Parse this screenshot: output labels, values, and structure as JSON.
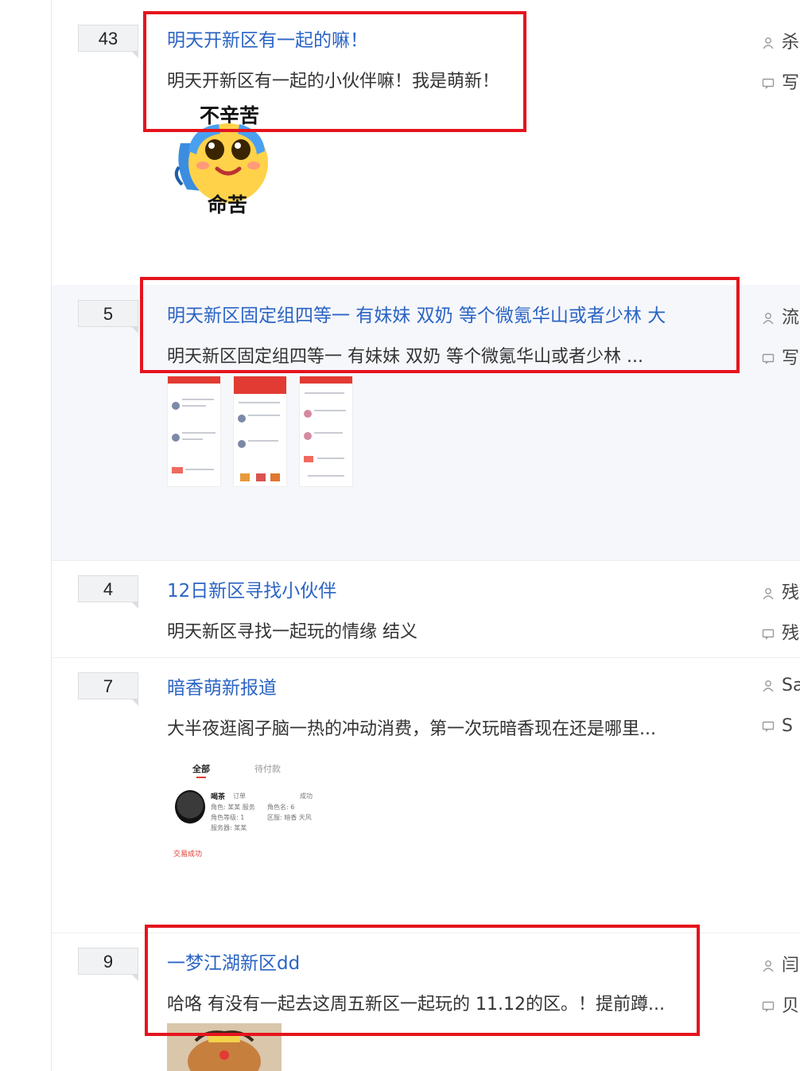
{
  "colors": {
    "title_link": "#2b64c4",
    "highlight_box": "#e5141d",
    "badge_bg": "#f1f2f4",
    "alt_row_bg": "#f6f7fb"
  },
  "icons": {
    "author": "person-icon",
    "reply": "comment-icon"
  },
  "rows": [
    {
      "count": "43",
      "title": "明天开新区有一起的嘛！",
      "snippet": "明天开新区有一起的小伙伴嘛！我是萌新！",
      "author": "杀",
      "last": "写",
      "emoji_top": "不辛苦",
      "emoji_bottom": "命苦"
    },
    {
      "count": "5",
      "title": "明天新区固定组四等一 有妹妹 双奶 等个微氪华山或者少林 大",
      "snippet": "明天新区固定组四等一 有妹妹 双奶 等个微氪华山或者少林 ...",
      "author": "流",
      "last": "写"
    },
    {
      "count": "4",
      "title": "12日新区寻找小伙伴",
      "snippet": "明天新区寻找一起玩的情缘 结义",
      "author": "残",
      "last": "残"
    },
    {
      "count": "7",
      "title": "暗香萌新报道",
      "snippet": "大半夜逛阁子脑一热的冲动消费，第一次玩暗香现在还是哪里...",
      "author": "Sa",
      "last": "S",
      "shot": {
        "tab_all": "全部",
        "tab_pending": "待付款",
        "name": "喝茶",
        "tag": "订单",
        "status": "成功",
        "line1": "角色: 某某 服务",
        "line2": "角色等级: 1",
        "line3": "服务器: 某某",
        "line4": "角色名: 6",
        "line5": "区服: 暗香 天风",
        "footer": "交易成功"
      }
    },
    {
      "count": "9",
      "title": "一梦江湖新区dd",
      "snippet": "哈咯 有没有一起去这周五新区一起玩的 11.12的区。！提前蹲...",
      "author": "闫",
      "last": "贝"
    }
  ]
}
